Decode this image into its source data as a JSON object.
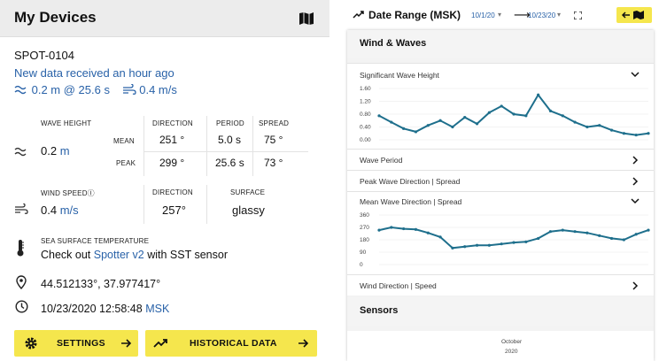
{
  "left": {
    "title": "My Devices",
    "device_id": "SPOT-0104",
    "new_data": "New data received an hour ago",
    "summary": {
      "wave": "0.2 m @ 25.6 s",
      "wind": "0.4 m/s"
    },
    "wave": {
      "heading": "WAVE HEIGHT",
      "value": "0.2",
      "unit": "m",
      "col_direction": "DIRECTION",
      "col_period": "PERIOD",
      "col_spread": "SPREAD",
      "row_mean": "MEAN",
      "row_peak": "PEAK",
      "mean": {
        "direction": "251 °",
        "period": "5.0 s",
        "spread": "75 °"
      },
      "peak": {
        "direction": "299 °",
        "period": "25.6 s",
        "spread": "73 °"
      }
    },
    "wind": {
      "heading": "WIND SPEED",
      "value": "0.4",
      "unit": "m/s",
      "col_direction": "DIRECTION",
      "col_surface": "SURFACE",
      "direction": "257°",
      "surface": "glassy"
    },
    "sst": {
      "heading": "SEA SURFACE TEMPERATURE",
      "pre": "Check out ",
      "link": "Spotter v2",
      "post": " with SST sensor"
    },
    "location": "44.512133°, 37.977417°",
    "timestamp": "10/23/2020 12:58:48",
    "timezone": "MSK",
    "buttons": {
      "settings": "SETTINGS",
      "historical": "HISTORICAL DATA"
    }
  },
  "right": {
    "title": "Date Range (MSK)",
    "date_from": "10/1/20",
    "date_to": "10/23/20",
    "sections": {
      "wind_waves": "Wind & Waves",
      "sensors": "Sensors"
    },
    "rows": {
      "sig_wave": "Significant Wave Height",
      "wave_period": "Wave Period",
      "peak_dir": "Peak Wave Direction | Spread",
      "mean_dir": "Mean Wave Direction | Spread",
      "wind_dir": "Wind Direction | Speed"
    },
    "x_axis": {
      "month": "October",
      "year": "2020"
    }
  },
  "colors": {
    "accent_yellow": "#f5e64d",
    "link_blue": "#2962a8",
    "series": "#1e6f8c"
  },
  "chart_data": [
    {
      "type": "line",
      "title": "Significant Wave Height",
      "y_ticks": [
        "1.60",
        "1.20",
        "0.80",
        "0.40",
        "0.00"
      ],
      "ylim": [
        0,
        1.6
      ],
      "x": [
        0,
        1,
        2,
        3,
        4,
        5,
        6,
        7,
        8,
        9,
        10,
        11,
        12,
        13,
        14,
        15,
        16,
        17,
        18,
        19,
        20,
        21,
        22
      ],
      "values": [
        0.75,
        0.55,
        0.35,
        0.25,
        0.45,
        0.6,
        0.4,
        0.7,
        0.5,
        0.85,
        1.05,
        0.8,
        0.75,
        1.4,
        0.9,
        0.75,
        0.55,
        0.4,
        0.45,
        0.3,
        0.2,
        0.15,
        0.2
      ]
    },
    {
      "type": "scatter",
      "title": "Mean Wave Direction | Spread",
      "y_ticks": [
        "360",
        "270",
        "180",
        "90",
        "0"
      ],
      "ylim": [
        0,
        360
      ],
      "x": [
        0,
        1,
        2,
        3,
        4,
        5,
        6,
        7,
        8,
        9,
        10,
        11,
        12,
        13,
        14,
        15,
        16,
        17,
        18,
        19,
        20,
        21,
        22
      ],
      "values": [
        250,
        270,
        260,
        255,
        230,
        200,
        120,
        130,
        140,
        140,
        150,
        160,
        165,
        190,
        240,
        250,
        240,
        230,
        210,
        190,
        180,
        220,
        250
      ]
    }
  ]
}
